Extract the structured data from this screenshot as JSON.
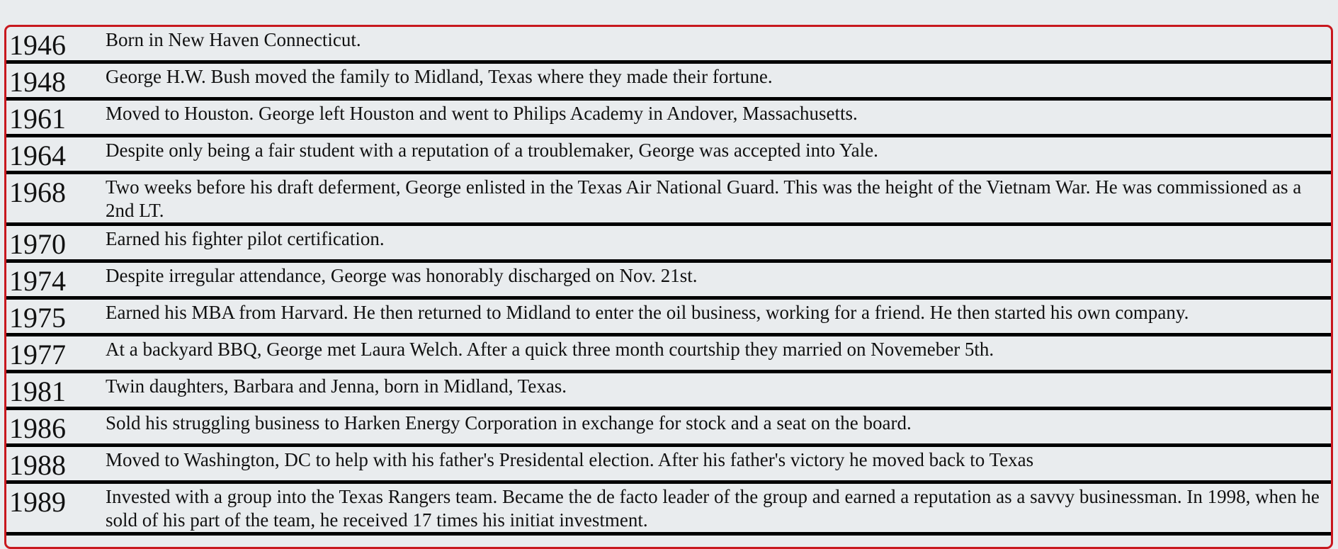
{
  "timeline": [
    {
      "year": "1946",
      "text": "Born in New Haven Connecticut.",
      "lines": 1
    },
    {
      "year": "1948",
      "text": "George H.W. Bush moved the family to Midland, Texas where they made their fortune.",
      "lines": 1
    },
    {
      "year": "1961",
      "text": "Moved to Houston. George left Houston and went to Philips Academy in Andover, Massachusetts.",
      "lines": 1
    },
    {
      "year": "1964",
      "text": "Despite only being a fair student with a reputation of a troublemaker, George was accepted into Yale.",
      "lines": 1
    },
    {
      "year": "1968",
      "text": "Two weeks before his draft deferment, George enlisted in the Texas Air National Guard. This was the height of the Vietnam War. He was commissioned as a 2nd LT.",
      "lines": 2
    },
    {
      "year": "1970",
      "text": "Earned his fighter pilot certification.",
      "lines": 1
    },
    {
      "year": "1974",
      "text": "Despite irregular attendance, George was honorably discharged on Nov. 21st.",
      "lines": 1
    },
    {
      "year": "1975",
      "text": "Earned his MBA from Harvard. He then returned to Midland to enter the oil business, working for a friend. He then started his own company.",
      "lines": 1
    },
    {
      "year": "1977",
      "text": "At a backyard BBQ, George met Laura Welch. After a quick three month courtship they married on Novemeber 5th.",
      "lines": 1
    },
    {
      "year": "1981",
      "text": "Twin daughters, Barbara and Jenna, born in Midland, Texas.",
      "lines": 1
    },
    {
      "year": "1986",
      "text": "Sold his struggling business to Harken Energy Corporation in exchange for stock and a seat on the board.",
      "lines": 1
    },
    {
      "year": "1988",
      "text": "Moved to Washington, DC to help with his father's Presidental election. After his father's victory he moved back to Texas",
      "lines": 1
    },
    {
      "year": "1989",
      "text": "Invested with a group into the Texas Rangers team. Became the de facto leader of the group and earned a reputation as a savvy businessman. In 1998, when he sold of his part of the team, he received 17 times his initiat investment.",
      "lines": 2
    }
  ]
}
